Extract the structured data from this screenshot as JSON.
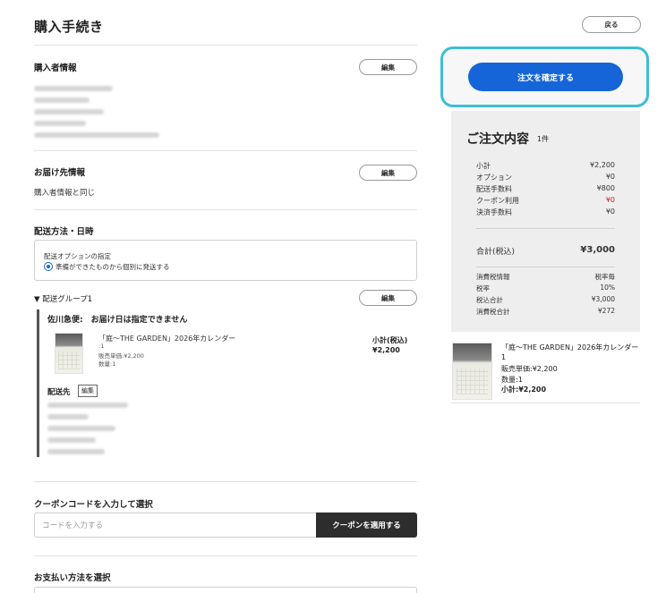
{
  "header": {
    "title": "購入手続き",
    "back_label": "戻る"
  },
  "buyer": {
    "title": "購入者情報",
    "edit_label": "編集"
  },
  "shipping_address": {
    "title": "お届け先情報",
    "edit_label": "編集",
    "value": "購入者情報と同じ"
  },
  "delivery": {
    "title": "配送方法・日時",
    "option_label": "配送オプションの指定",
    "option_value": "準備ができたものから個別に発送する"
  },
  "group": {
    "title": "▼ 配送グループ1",
    "edit_label": "編集",
    "carrier_note": "佐川急便:　お届け日は指定できません",
    "product": {
      "name": "「庭〜THE GARDEN」2026年カレンダー",
      "variant": ":1",
      "unit_price": "販売単価:¥2,200",
      "quantity": "数量:1",
      "subtotal_label": "小計(税込)",
      "subtotal_value": "¥2,200"
    },
    "destination_label": "配送先",
    "destination_edit": "編集"
  },
  "coupon": {
    "title": "クーポンコードを入力して選択",
    "placeholder": "コードを入力する",
    "apply_label": "クーポンを適用する"
  },
  "payment": {
    "title": "お支払い方法を選択"
  },
  "confirm": {
    "label": "注文を確定する"
  },
  "summary": {
    "title": "ご注文内容",
    "count": "1件",
    "rows": [
      {
        "label": "小計",
        "value": "¥2,200"
      },
      {
        "label": "オプション",
        "value": "¥0"
      },
      {
        "label": "配送手数料",
        "value": "¥800"
      },
      {
        "label": "クーポン利用",
        "value": "¥0",
        "accent": "#d81b1b"
      },
      {
        "label": "決済手数料",
        "value": "¥0"
      }
    ],
    "total_label": "合計(税込)",
    "total_value": "¥3,000",
    "tax_rows": [
      {
        "label": "消費税情報",
        "value": "税率毎"
      },
      {
        "label": "税率",
        "value": "10%"
      },
      {
        "label": "税込合計",
        "value": "¥3,000"
      },
      {
        "label": "消費税合計",
        "value": "¥272"
      }
    ]
  },
  "mini_item": {
    "name_line1": "「庭〜THE GARDEN」2026年カレンダー",
    "name_line2": "1",
    "unit_price": "販売単価:¥2,200",
    "quantity": "数量:1",
    "subtotal": "小計:¥2,200"
  },
  "colors": {
    "accent_blue": "#1565d8",
    "highlight_ring": "#3dbdd6",
    "coupon_red": "#d81b1b",
    "dark_button": "#2d2d2d"
  }
}
